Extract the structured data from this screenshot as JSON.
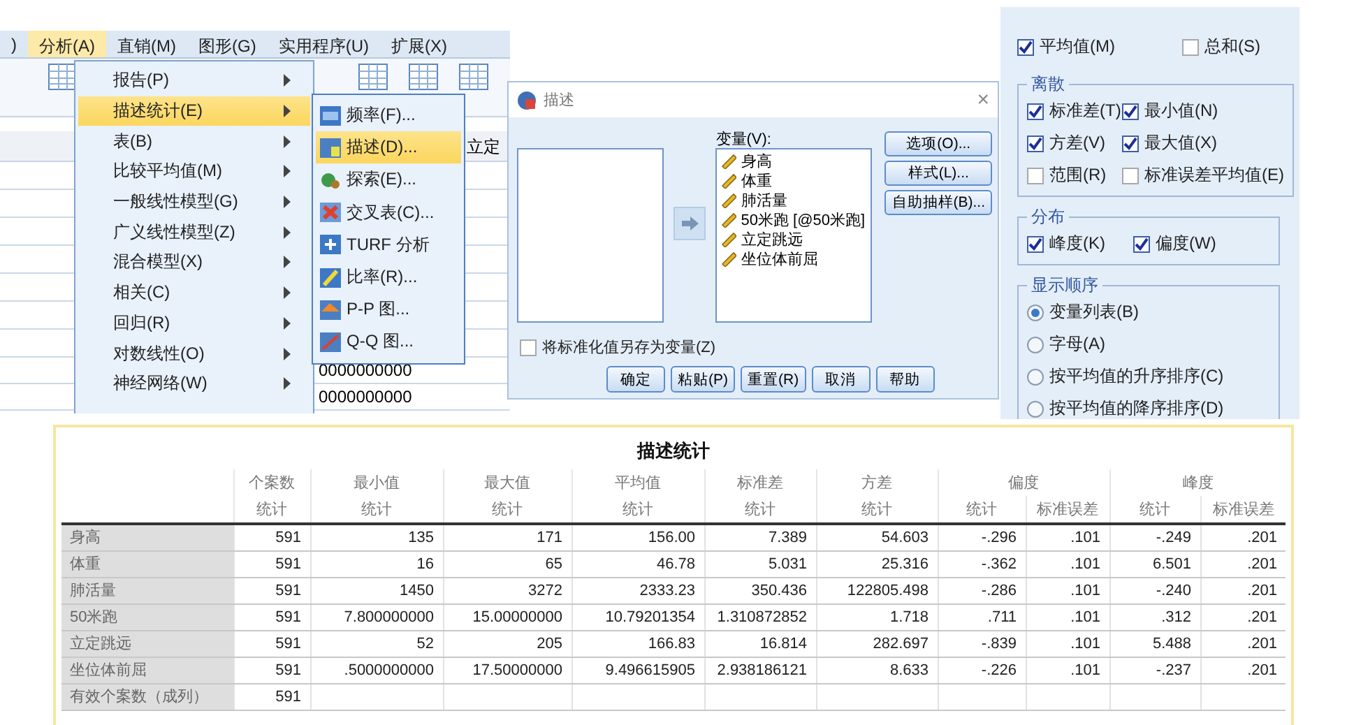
{
  "data_editor": {
    "menubar": [
      {
        "label": ")",
        "selected": false
      },
      {
        "label": "分析(A)",
        "selected": true
      },
      {
        "label": "直销(M)",
        "selected": false
      },
      {
        "label": "图形(G)",
        "selected": false
      },
      {
        "label": "实用程序(U)",
        "selected": false
      },
      {
        "label": "扩展(X)",
        "selected": false
      }
    ],
    "grid": {
      "column_header": "立定",
      "cells": [
        "0000000000",
        "0000000000"
      ]
    },
    "menu": [
      {
        "label": "报告(P)",
        "selected": false
      },
      {
        "label": "描述统计(E)",
        "selected": true
      },
      {
        "label": "表(B)",
        "selected": false
      },
      {
        "label": "比较平均值(M)",
        "selected": false
      },
      {
        "label": "一般线性模型(G)",
        "selected": false
      },
      {
        "label": "广义线性模型(Z)",
        "selected": false
      },
      {
        "label": "混合模型(X)",
        "selected": false
      },
      {
        "label": "相关(C)",
        "selected": false
      },
      {
        "label": "回归(R)",
        "selected": false
      },
      {
        "label": "对数线性(O)",
        "selected": false
      },
      {
        "label": "神经网络(W)",
        "selected": false
      }
    ],
    "submenu": [
      {
        "label": "频率(F)...",
        "kind": "frequency",
        "selected": false
      },
      {
        "label": "描述(D)...",
        "kind": "descriptive",
        "selected": true
      },
      {
        "label": "探索(E)...",
        "kind": "explore",
        "selected": false
      },
      {
        "label": "交叉表(C)...",
        "kind": "crosstab",
        "selected": false
      },
      {
        "label": "TURF 分析",
        "kind": "turf",
        "selected": false
      },
      {
        "label": "比率(R)...",
        "kind": "ratio",
        "selected": false
      },
      {
        "label": "P-P 图...",
        "kind": "pp",
        "selected": false
      },
      {
        "label": "Q-Q 图...",
        "kind": "qq",
        "selected": false
      }
    ]
  },
  "dialog": {
    "title": "描述",
    "close": "×",
    "variables_label": "变量(V):",
    "variables": [
      "身高",
      "体重",
      "肺活量",
      "50米跑 [@50米跑]",
      "立定跳远",
      "坐位体前屈"
    ],
    "side_buttons": [
      "选项(O)...",
      "样式(L)...",
      "自助抽样(B)..."
    ],
    "save_standardized": {
      "label": "将标准化值另存为变量(Z)",
      "checked": false
    },
    "buttons": [
      "确定",
      "粘贴(P)",
      "重置(R)",
      "取消",
      "帮助"
    ]
  },
  "options": {
    "top": [
      {
        "label": "平均值(M)",
        "checked": true
      },
      {
        "label": "总和(S)",
        "checked": false
      }
    ],
    "dispersion": {
      "title": "离散",
      "items": [
        {
          "label": "标准差(T)",
          "checked": true
        },
        {
          "label": "最小值(N)",
          "checked": true
        },
        {
          "label": "方差(V)",
          "checked": true
        },
        {
          "label": "最大值(X)",
          "checked": true
        },
        {
          "label": "范围(R)",
          "checked": false
        },
        {
          "label": "标准误差平均值(E)",
          "checked": false
        }
      ]
    },
    "distribution": {
      "title": "分布",
      "items": [
        {
          "label": "峰度(K)",
          "checked": true
        },
        {
          "label": "偏度(W)",
          "checked": true
        }
      ]
    },
    "display_order": {
      "title": "显示顺序",
      "items": [
        {
          "label": "变量列表(B)",
          "selected": true
        },
        {
          "label": "字母(A)",
          "selected": false
        },
        {
          "label": "按平均值的升序排序(C)",
          "selected": false
        },
        {
          "label": "按平均值的降序排序(D)",
          "selected": false
        }
      ]
    }
  },
  "table": {
    "title": "描述统计",
    "column_groups": [
      {
        "label": "个案数",
        "columns": [
          "统计"
        ]
      },
      {
        "label": "最小值",
        "columns": [
          "统计"
        ]
      },
      {
        "label": "最大值",
        "columns": [
          "统计"
        ]
      },
      {
        "label": "平均值",
        "columns": [
          "统计"
        ]
      },
      {
        "label": "标准差",
        "columns": [
          "统计"
        ]
      },
      {
        "label": "方差",
        "columns": [
          "统计"
        ]
      },
      {
        "label": "偏度",
        "columns": [
          "统计",
          "标准误差"
        ]
      },
      {
        "label": "峰度",
        "columns": [
          "统计",
          "标准误差"
        ]
      }
    ],
    "rows": [
      {
        "label": "身高",
        "cells": [
          "591",
          "135",
          "171",
          "156.00",
          "7.389",
          "54.603",
          "-.296",
          ".101",
          "-.249",
          ".201"
        ]
      },
      {
        "label": "体重",
        "cells": [
          "591",
          "16",
          "65",
          "46.78",
          "5.031",
          "25.316",
          "-.362",
          ".101",
          "6.501",
          ".201"
        ]
      },
      {
        "label": "肺活量",
        "cells": [
          "591",
          "1450",
          "3272",
          "2333.23",
          "350.436",
          "122805.498",
          "-.286",
          ".101",
          "-.240",
          ".201"
        ]
      },
      {
        "label": "50米跑",
        "cells": [
          "591",
          "7.800000000",
          "15.00000000",
          "10.79201354",
          "1.310872852",
          "1.718",
          ".711",
          ".101",
          ".312",
          ".201"
        ]
      },
      {
        "label": "立定跳远",
        "cells": [
          "591",
          "52",
          "205",
          "166.83",
          "16.814",
          "282.697",
          "-.839",
          ".101",
          "5.488",
          ".201"
        ]
      },
      {
        "label": "坐位体前屈",
        "cells": [
          "591",
          ".5000000000",
          "17.50000000",
          "9.496615905",
          "2.938186121",
          "8.633",
          "-.226",
          ".101",
          "-.237",
          ".201"
        ]
      },
      {
        "label": "有效个案数（成列）",
        "cells": [
          "591"
        ]
      }
    ]
  }
}
